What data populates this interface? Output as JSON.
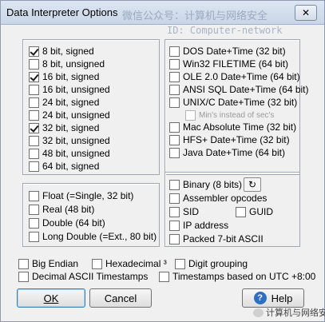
{
  "window": {
    "title": "Data Interpreter Options",
    "watermark_line1": "微信公众号：计算机与网络安全",
    "watermark_line2": "ID: Computer-network",
    "close_label": "✕"
  },
  "integers": [
    {
      "label": "8 bit, signed",
      "checked": true
    },
    {
      "label": "8 bit, unsigned",
      "checked": false
    },
    {
      "label": "16 bit, signed",
      "checked": true
    },
    {
      "label": "16 bit, unsigned",
      "checked": false
    },
    {
      "label": "24 bit, signed",
      "checked": false
    },
    {
      "label": "24 bit, unsigned",
      "checked": false
    },
    {
      "label": "32 bit, signed",
      "checked": true
    },
    {
      "label": "32 bit, unsigned",
      "checked": false
    },
    {
      "label": "48 bit, unsigned",
      "checked": false
    },
    {
      "label": "64 bit, signed",
      "checked": false
    }
  ],
  "dates": [
    {
      "label": "DOS Date+Time (32 bit)",
      "checked": false
    },
    {
      "label": "Win32 FILETIME (64 bit)",
      "checked": false
    },
    {
      "label": "OLE 2.0 Date+Time (64 bit)",
      "checked": false
    },
    {
      "label": "ANSI SQL Date+Time (64 bit)",
      "checked": false
    },
    {
      "label": "UNIX/C Date+Time (32 bit)",
      "checked": false
    },
    {
      "label": "Min's instead of sec's",
      "checked": false,
      "disabled": true
    },
    {
      "label": "Mac Absolute Time (32 bit)",
      "checked": false
    },
    {
      "label": "HFS+ Date+Time (32 bit)",
      "checked": false
    },
    {
      "label": "Java Date+Time (64 bit)",
      "checked": false
    }
  ],
  "floats": [
    {
      "label": "Float (=Single, 32 bit)",
      "checked": false
    },
    {
      "label": "Real (48 bit)",
      "checked": false
    },
    {
      "label": "Double (64 bit)",
      "checked": false
    },
    {
      "label": "Long Double (=Ext., 80 bit)",
      "checked": false
    }
  ],
  "misc": {
    "binary": {
      "label": "Binary (8 bits)",
      "checked": false
    },
    "refresh_label": "↻",
    "assembler": {
      "label": "Assembler opcodes",
      "checked": false
    },
    "sid": {
      "label": "SID",
      "checked": false
    },
    "guid": {
      "label": "GUID",
      "checked": false
    },
    "ip": {
      "label": "IP address",
      "checked": false
    },
    "packed": {
      "label": "Packed 7-bit ASCII",
      "checked": false
    }
  },
  "options": {
    "big_endian": {
      "label": "Big Endian",
      "checked": false
    },
    "hexadecimal": {
      "label": "Hexadecimal ³",
      "checked": false
    },
    "digit_grouping": {
      "label": "Digit grouping",
      "checked": false
    },
    "decimal_ascii": {
      "label": "Decimal ASCII Timestamps",
      "checked": false
    },
    "utc": {
      "label": "Timestamps based on UTC +8:00",
      "checked": false
    }
  },
  "buttons": {
    "ok": "OK",
    "cancel": "Cancel",
    "help": "Help",
    "help_icon": "?"
  },
  "footer_watermark": "计算机与网络安全"
}
